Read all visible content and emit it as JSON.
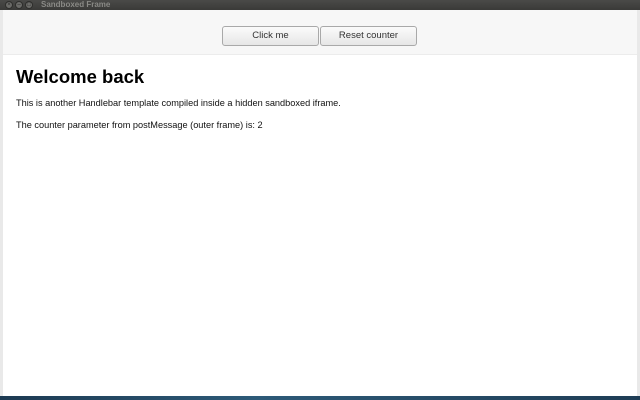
{
  "window": {
    "title": "Sandboxed Frame",
    "controls": [
      "close-icon",
      "minimize-icon",
      "maximize-icon"
    ]
  },
  "toolbar": {
    "click_label": "Click me",
    "reset_label": "Reset counter"
  },
  "main": {
    "heading": "Welcome back",
    "paragraph1": "This is another Handlebar template compiled inside a hidden sandboxed iframe.",
    "paragraph2": "The counter parameter from postMessage (outer frame) is: 2"
  }
}
